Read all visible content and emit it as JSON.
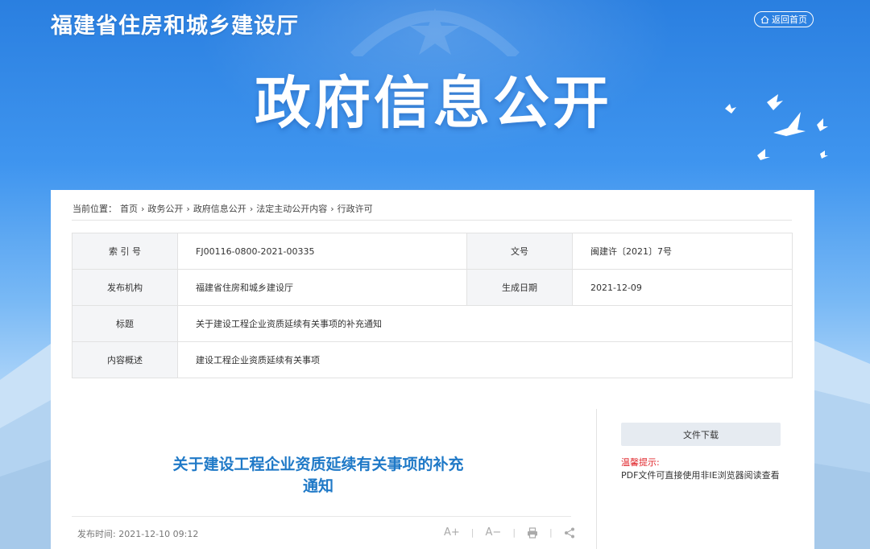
{
  "header": {
    "site_title": "福建省住房和城乡建设厅",
    "home_label": "返回首页",
    "hero_title": "政府信息公开"
  },
  "breadcrumb": {
    "prefix": "当前位置：",
    "items": [
      "首页",
      "政务公开",
      "政府信息公开",
      "法定主动公开内容",
      "行政许可"
    ],
    "separator": "›"
  },
  "meta": {
    "index_label": "索 引 号",
    "index_value": "FJ00116-0800-2021-00335",
    "docno_label": "文号",
    "docno_value": "闽建许〔2021〕7号",
    "publisher_label": "发布机构",
    "publisher_value": "福建省住房和城乡建设厅",
    "date_label": "生成日期",
    "date_value": "2021-12-09",
    "title_label": "标题",
    "title_value": "关于建设工程企业资质延续有关事项的补充通知",
    "summary_label": "内容概述",
    "summary_value": "建设工程企业资质延续有关事项"
  },
  "article": {
    "title_line1": "关于建设工程企业资质延续有关事项的补充",
    "title_line2": "通知",
    "pub_label": "发布时间:",
    "pub_value": "2021-12-10 09:12",
    "font_increase": "A+",
    "font_decrease": "A−"
  },
  "sidebar": {
    "download_label": "文件下载",
    "tip_label": "温馨提示:",
    "tip_text": "PDF文件可直接使用非IE浏览器阅读查看"
  },
  "colors": {
    "accent": "#1f79c7",
    "tip_red": "#e0262b",
    "banner_top": "#2a7fe0"
  }
}
